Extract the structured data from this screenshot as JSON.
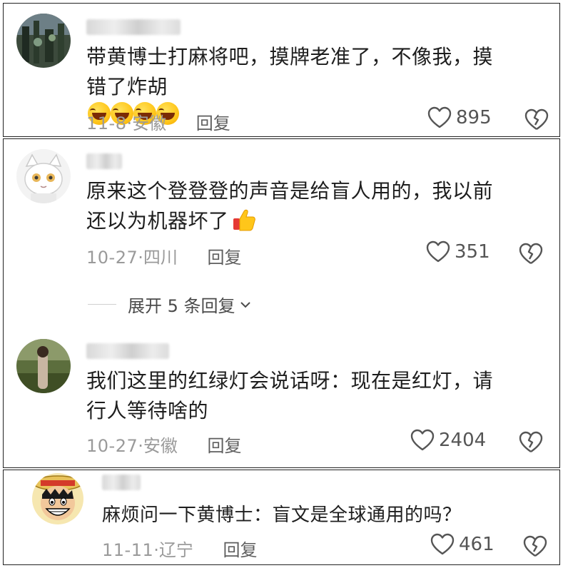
{
  "comments": [
    {
      "text_lines": [
        "带黄博士打麻将吧，摸牌老准了，不像我，摸",
        "错了炸胡"
      ],
      "emoji": "face-with-tears-of-joy",
      "emoji_count": 4,
      "date": "11-8",
      "location": "安徽",
      "reply_label": "回复",
      "likes": "895"
    },
    {
      "text_lines": [
        "原来这个登登登的声音是给盲人用的，我以前",
        "还以为机器坏了"
      ],
      "emoji": "thumbs-up",
      "date": "10-27",
      "location": "四川",
      "reply_label": "回复",
      "likes": "351",
      "expand_replies": "展开 5 条回复"
    },
    {
      "text_lines": [
        "我们这里的红绿灯会说话呀：现在是红灯，请",
        "行人等待啥的"
      ],
      "date": "10-27",
      "location": "安徽",
      "reply_label": "回复",
      "likes": "2404"
    },
    {
      "text_lines": [
        "麻烦问一下黄博士：盲文是全球通用的吗？"
      ],
      "date": "11-11",
      "location": "辽宁",
      "reply_label": "回复",
      "likes": "461"
    }
  ],
  "separator": "·",
  "colors": {
    "text": "#1e1e1e",
    "meta": "#9a9a9a",
    "reply": "#5e5e5e",
    "icon": "#555555",
    "border": "#222222"
  }
}
